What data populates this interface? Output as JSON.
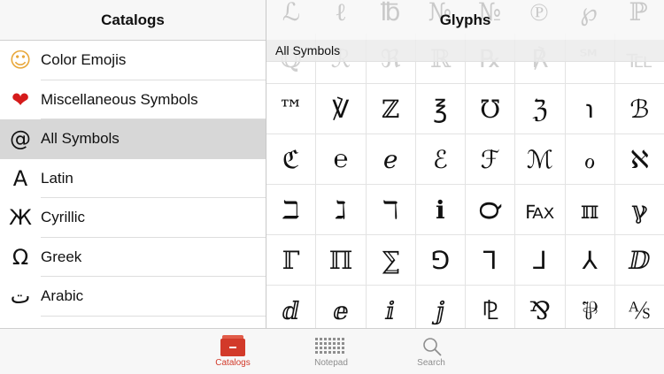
{
  "left_panel": {
    "title": "Catalogs",
    "items": [
      {
        "icon": "☺",
        "label": "Color Emojis",
        "icon_name": "smiling-face-icon"
      },
      {
        "icon": "❤",
        "label": "Miscellaneous Symbols",
        "icon_name": "heart-icon"
      },
      {
        "icon": "@",
        "label": "All Symbols",
        "icon_name": "at-sign-icon",
        "selected": true
      },
      {
        "icon": "A",
        "label": "Latin",
        "icon_name": "latin-a-icon"
      },
      {
        "icon": "Ж",
        "label": "Cyrillic",
        "icon_name": "cyrillic-zhe-icon"
      },
      {
        "icon": "Ω",
        "label": "Greek",
        "icon_name": "omega-icon"
      },
      {
        "icon": "ت",
        "label": "Arabic",
        "icon_name": "arabic-teh-icon"
      }
    ]
  },
  "right_panel": {
    "title": "Glyphs",
    "section_label": "All Symbols",
    "ghost_glyphs": [
      "ℒ",
      "ℓ",
      "℔",
      "№",
      "№",
      "℗",
      "℘",
      "ℙ"
    ],
    "faded_row": [
      "ℚ",
      "ℛ",
      "ℜ",
      "ℝ",
      "℞",
      "℟",
      "℠",
      "℡"
    ],
    "rows": [
      [
        "™",
        "℣",
        "ℤ",
        "℥",
        "℧",
        "ℨ",
        "℩",
        "ℬ"
      ],
      [
        "ℭ",
        "℮",
        "ℯ",
        "ℰ",
        "ℱ",
        "ℳ",
        "ℴ",
        "ℵ"
      ],
      [
        "ℶ",
        "ℷ",
        "ℸ",
        "ℹ",
        "℺",
        "℻",
        "ℼ",
        "ℽ"
      ],
      [
        "ℾ",
        "ℿ",
        "⅀",
        "⅁",
        "⅂",
        "⅃",
        "⅄",
        "ⅅ"
      ],
      [
        "ⅆ",
        "ⅇ",
        "ⅈ",
        "ⅉ",
        "⅊",
        "⅋",
        "⅌",
        "⅍"
      ]
    ]
  },
  "tab_bar": {
    "active_color": "#d23a2a",
    "tabs": [
      {
        "label": "Catalogs",
        "icon_name": "folder-icon",
        "active": true
      },
      {
        "label": "Notepad",
        "icon_name": "keyboard-icon",
        "active": false
      },
      {
        "label": "Search",
        "icon_name": "magnifier-icon",
        "active": false
      }
    ]
  }
}
